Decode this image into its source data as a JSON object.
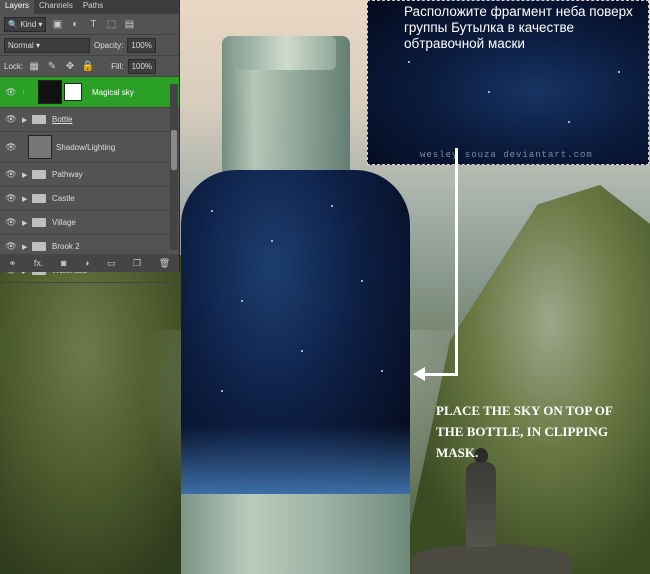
{
  "panel": {
    "tabs": [
      "Layers",
      "Channels",
      "Paths"
    ],
    "filter_kind": "Kind",
    "blend_mode": "Normal",
    "opacity_label": "Opacity:",
    "opacity_value": "100%",
    "lock_label": "Lock:",
    "fill_label": "Fill:",
    "fill_value": "100%",
    "layers": [
      {
        "name": "Magical sky",
        "selected": true
      },
      {
        "name": "Bottle"
      },
      {
        "name": "Shadow/Lighting"
      },
      {
        "name": "Pathway"
      },
      {
        "name": "Castle"
      },
      {
        "name": "Village"
      },
      {
        "name": "Brook 2"
      },
      {
        "name": "Waterfalls"
      }
    ],
    "bottom_icons": [
      "link-icon",
      "fx-icon",
      "mask-icon",
      "adjustment-icon",
      "folder-icon",
      "new-layer-icon",
      "trash-icon"
    ],
    "fx_text": "fx."
  },
  "annotation_ru": "Расположите фрагмент неба поверх группы Бутылка в качестве обтравочной маски",
  "annotation_en": "PLACE THE SKY ON TOP OF THE BOTTLE, IN CLIPPING MASK.",
  "watermark": "wesley souza deviantart.com",
  "colors": {
    "selection": "#2aa027",
    "panel_bg": "#535353"
  }
}
